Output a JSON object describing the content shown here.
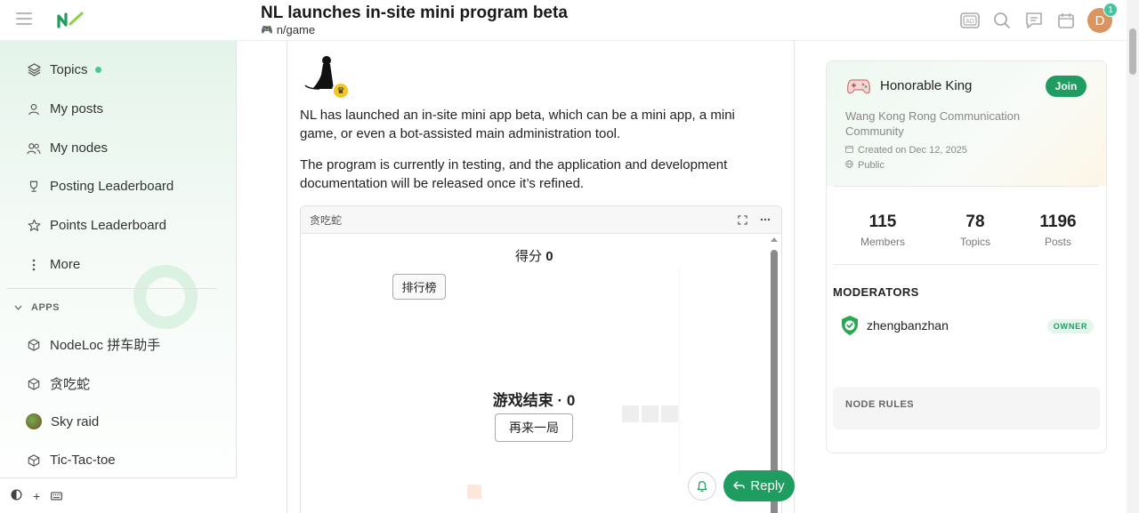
{
  "header": {
    "title": "NL launches in-site mini program beta",
    "category": "n/game",
    "avatar_letter": "D",
    "notification_count": "1",
    "icons": [
      "ad-icon",
      "search-icon",
      "chat-icon",
      "calendar-icon"
    ]
  },
  "sidebar": {
    "nav": [
      {
        "label": "Topics",
        "icon": "layers-icon",
        "has_dot": true
      },
      {
        "label": "My posts",
        "icon": "user-icon"
      },
      {
        "label": "My nodes",
        "icon": "users-icon"
      },
      {
        "label": "Posting Leaderboard",
        "icon": "trophy-icon"
      },
      {
        "label": "Points Leaderboard",
        "icon": "star-icon"
      },
      {
        "label": "More",
        "icon": "more-vertical-icon"
      }
    ],
    "apps_header": "APPS",
    "apps": [
      {
        "label": "NodeLoc 拼车助手",
        "icon": "cube-icon"
      },
      {
        "label": "贪吃蛇",
        "icon": "cube-icon"
      },
      {
        "label": "Sky raid",
        "icon": "app-avatar-icon"
      },
      {
        "label": "Tic-Tac-toe",
        "icon": "cube-icon"
      }
    ],
    "footer": {
      "add": "+"
    }
  },
  "post": {
    "paragraph1": "NL has launched an in-site mini app beta, which can be a mini app, a mini game, or even a bot-assisted main administration tool.",
    "paragraph2": "The program is currently in testing, and the application and development documentation will be released once it’s refined.",
    "mini_app": {
      "title": "贪吃蛇",
      "score_label": "得分",
      "score_value": "0",
      "leaderboard_button": "排行榜",
      "game_over": "游戏结束 · 0",
      "play_again_button": "再来一局"
    },
    "reply_label": "Reply"
  },
  "node": {
    "name": "Honorable King",
    "join_label": "Join",
    "description": "Wang Kong Rong Communication Community",
    "created": "Created on Dec 12, 2025",
    "visibility": "Public",
    "stats": [
      {
        "value": "115",
        "label": "Members"
      },
      {
        "value": "78",
        "label": "Topics"
      },
      {
        "value": "1196",
        "label": "Posts"
      }
    ],
    "moderators_header": "MODERATORS",
    "moderator": {
      "name": "zhengbanzhan",
      "badge": "OWNER"
    },
    "rules_header": "NODE RULES"
  },
  "colors": {
    "accent": "#1f9d60",
    "dot": "#3ecf8e",
    "avatar": "#d9955f"
  }
}
